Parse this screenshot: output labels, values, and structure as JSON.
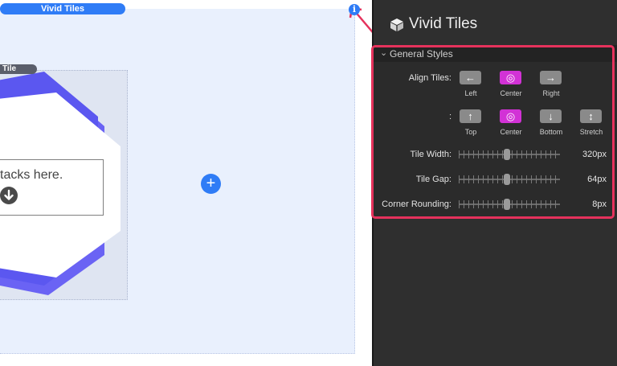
{
  "canvas": {
    "top_pill_label": "Vivid Tiles",
    "tile_tag_label": "Tile",
    "content_text": "tacks here.",
    "plus_label": "+",
    "info_label": "i"
  },
  "panel": {
    "title": "Vivid Tiles",
    "section_title": "General Styles",
    "align_tiles_label": "Align Tiles:",
    "horizontal": [
      {
        "glyph": "←",
        "caption": "Left",
        "selected": false
      },
      {
        "glyph": "◎",
        "caption": "Center",
        "selected": true
      },
      {
        "glyph": "→",
        "caption": "Right",
        "selected": false
      }
    ],
    "vertical_label": ":",
    "vertical": [
      {
        "glyph": "↑",
        "caption": "Top",
        "selected": false
      },
      {
        "glyph": "◎",
        "caption": "Center",
        "selected": true
      },
      {
        "glyph": "↓",
        "caption": "Bottom",
        "selected": false
      },
      {
        "glyph": "↕",
        "caption": "Stretch",
        "selected": false
      }
    ],
    "sliders": [
      {
        "label": "Tile Width:",
        "value": "320px",
        "level": 0.48
      },
      {
        "label": "Tile Gap:",
        "value": "64px",
        "level": 0.48
      },
      {
        "label": "Corner Rounding:",
        "value": "8px",
        "level": 0.48
      }
    ]
  },
  "colors": {
    "accent_blue": "#2f7cf6",
    "selected_magenta": "#d232d6",
    "highlight_red": "#e5325c",
    "hex_purple": "#5b57f0"
  }
}
